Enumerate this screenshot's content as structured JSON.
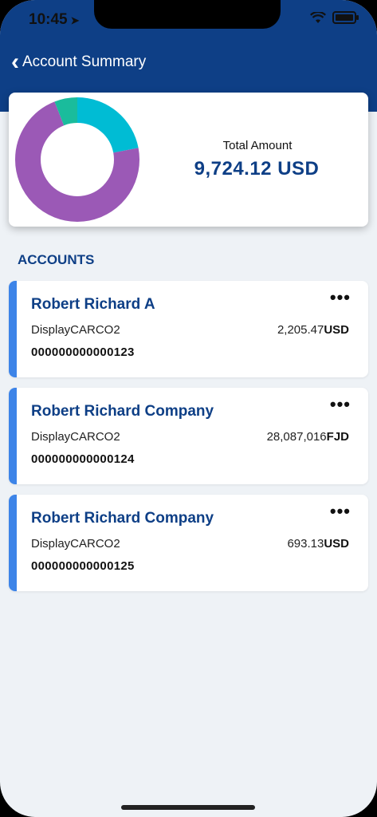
{
  "status": {
    "time": "10:45"
  },
  "nav": {
    "title": "Account Summary"
  },
  "summary": {
    "total_label": "Total Amount",
    "total_value": "9,724.12 USD",
    "donut_segments": [
      {
        "fraction": 0.22,
        "color": "#00bcd4"
      },
      {
        "fraction": 0.72,
        "color": "#9b59b6"
      },
      {
        "fraction": 0.06,
        "color": "#1abc9c"
      }
    ]
  },
  "section": {
    "title": "ACCOUNTS"
  },
  "accounts": [
    {
      "name": "Robert Richard A",
      "display": "DisplayCARCO2",
      "amount": "2,205.47",
      "currency": "USD",
      "number": "000000000000123"
    },
    {
      "name": "Robert Richard Company",
      "display": "DisplayCARCO2",
      "amount": "28,087,016",
      "currency": "FJD",
      "number": "000000000000124"
    },
    {
      "name": "Robert Richard Company",
      "display": "DisplayCARCO2",
      "amount": "693.13",
      "currency": "USD",
      "number": "000000000000125"
    }
  ],
  "colors": {
    "brand": "#0e3f86",
    "accent": "#3d84e8"
  }
}
